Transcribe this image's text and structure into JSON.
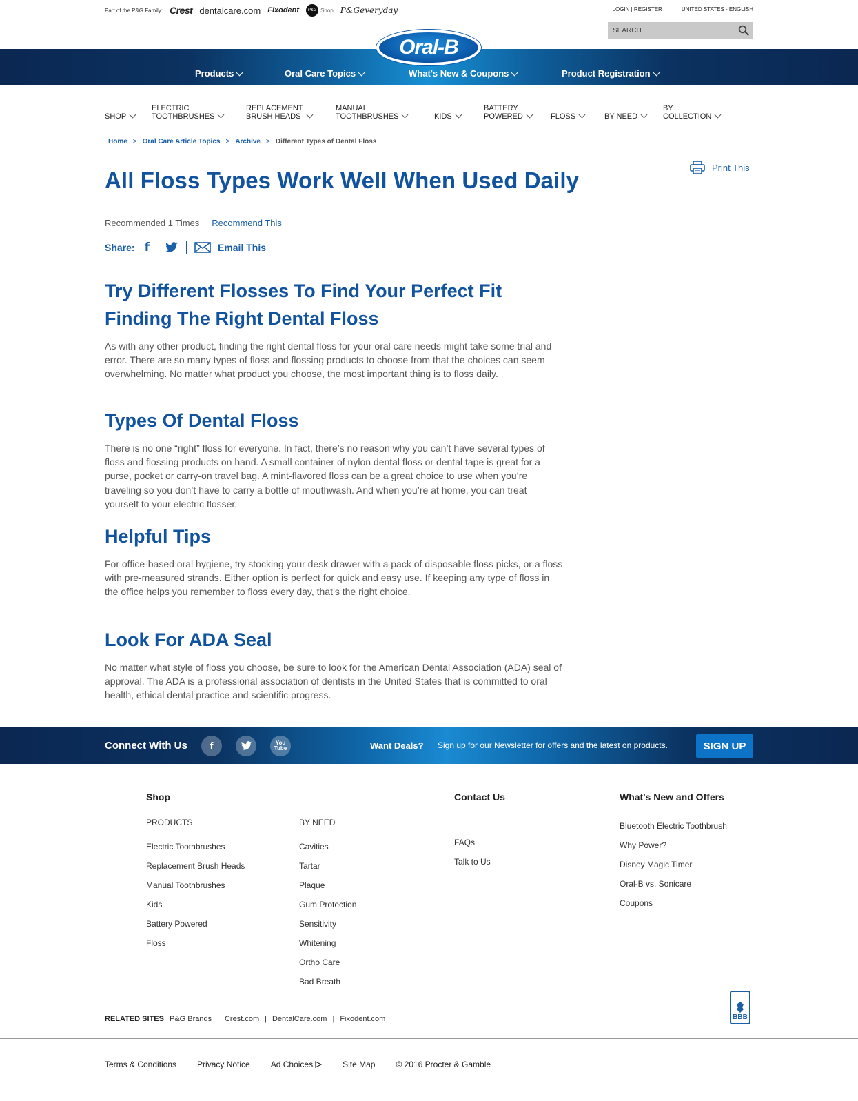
{
  "utility": {
    "family_label": "Part of the P&G Family:",
    "brands": [
      "Crest",
      "dentalcare.com",
      "Fixodent",
      "Shop",
      "P&Geveryday"
    ],
    "pg_badge": "P&G",
    "login": "LOGIN | REGISTER",
    "locale": "UNITED STATES - ENGLISH",
    "search_placeholder": "SEARCH"
  },
  "logo": "Oral-B",
  "main_nav": [
    "Products",
    "Oral Care Topics",
    "What's New & Coupons",
    "Product Registration"
  ],
  "categories": [
    {
      "l1": "",
      "l2": "SHOP"
    },
    {
      "l1": "ELECTRIC",
      "l2": "TOOTHBRUSHES"
    },
    {
      "l1": "REPLACEMENT",
      "l2": "BRUSH HEADS"
    },
    {
      "l1": "MANUAL",
      "l2": "TOOTHBRUSHES"
    },
    {
      "l1": "",
      "l2": "KIDS"
    },
    {
      "l1": "BATTERY",
      "l2": "POWERED"
    },
    {
      "l1": "",
      "l2": "FLOSS"
    },
    {
      "l1": "",
      "l2": "BY NEED"
    },
    {
      "l1": "BY",
      "l2": "COLLECTION"
    }
  ],
  "breadcrumb": {
    "items": [
      "Home",
      "Oral Care Article Topics",
      "Archive"
    ],
    "separator": ">",
    "current": "Different Types of Dental Floss"
  },
  "article": {
    "print_label": "Print This",
    "title": "All Floss Types Work Well When Used Daily",
    "recommended": "Recommended 1 Times",
    "recommend_link": "Recommend This",
    "share_label": "Share:",
    "facebook_glyph": "f",
    "email_link": "Email This",
    "sections": [
      {
        "h1": "Try Different Flosses To Find Your Perfect Fit",
        "h2": "Finding The Right Dental Floss",
        "body": "As with any other product, finding the right dental floss for your oral care needs might take some trial and error. There are so many types of floss and flossing products to choose from that the choices can seem overwhelming. No matter what product you choose, the most important thing is to floss daily."
      },
      {
        "h": "Types Of Dental Floss",
        "body": "There is no one “right” floss for everyone. In fact, there’s no reason why you can’t have several types of floss and flossing products on hand. A small container of nylon dental floss or dental tape is great for a purse, pocket or carry-on travel bag. A mint-flavored floss can be a great choice to use when you’re traveling so you don’t have to carry a bottle of mouthwash. And when you’re at home, you can treat yourself to your electric flosser."
      },
      {
        "h": "Helpful Tips",
        "body": "For office-based oral hygiene, try stocking your desk drawer with a pack of disposable floss picks, or a floss with pre-measured strands. Either option is perfect for quick and easy use. If keeping any type of floss in the office helps you remember to floss every day, that’s the right choice."
      },
      {
        "h": "Look For ADA Seal",
        "body": "No matter what style of floss you choose, be sure to look for the American Dental Association (ADA) seal of approval. The ADA is a professional association of dentists in the United States that is committed to oral health, ethical dental practice and scientific progress."
      }
    ]
  },
  "connect": {
    "title": "Connect With Us",
    "social": [
      "f",
      "You",
      "Tube"
    ],
    "deals": "Want Deals?",
    "newsletter": "Sign up for our Newsletter for offers and the latest on products.",
    "signup": "SIGN UP"
  },
  "footer": {
    "shop_title": "Shop",
    "products_title": "PRODUCTS",
    "products": [
      "Electric Toothbrushes",
      "Replacement Brush Heads",
      "Manual Toothbrushes",
      "Kids",
      "Battery Powered",
      "Floss"
    ],
    "byneed_title": "BY NEED",
    "byneed": [
      "Cavities",
      "Tartar",
      "Plaque",
      "Gum Protection",
      "Sensitivity",
      "Whitening",
      "Ortho Care",
      "Bad Breath"
    ],
    "contact_title": "Contact Us",
    "contact": [
      "FAQs",
      "Talk to Us"
    ],
    "whatsnew_title": "What's New and Offers",
    "whatsnew": [
      "Bluetooth Electric Toothbrush",
      "Why Power?",
      "Disney Magic Timer",
      "Oral-B vs. Sonicare",
      "Coupons"
    ],
    "bbb": "BBB",
    "related_label": "RELATED SITES",
    "related": [
      "P&G Brands",
      "Crest.com",
      "DentalCare.com",
      "Fixodent.com"
    ],
    "legal": [
      "Terms & Conditions",
      "Privacy Notice",
      "Ad Choices",
      "Site Map",
      "© 2016 Procter & Gamble"
    ]
  },
  "colors": {
    "brand_blue": "#12539f",
    "link_blue": "#1a5fa8",
    "nav_dark": "#0b2752",
    "signup_blue": "#0d73c7"
  }
}
